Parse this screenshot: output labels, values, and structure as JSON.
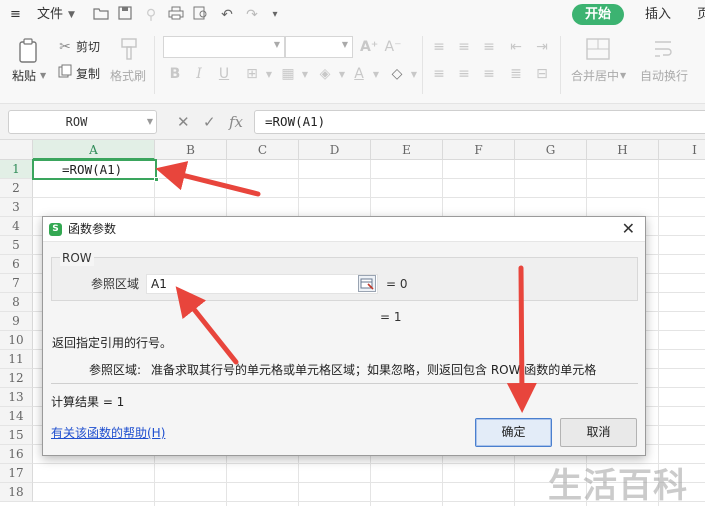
{
  "menubar": {
    "menu_icon": "hamburger-icon",
    "file_label": "文件",
    "file_dropdown": "chevron-down-icon",
    "quick_access": [
      "open-folder-icon",
      "save-icon",
      "format-painter-icon",
      "print-icon",
      "print-preview-icon",
      "undo-icon",
      "redo-icon",
      "customize-icon"
    ],
    "tab_start": "开始",
    "tab_insert": "插入",
    "tab_page": "页"
  },
  "ribbon": {
    "paste_label": "粘贴",
    "cut_label": "剪切",
    "copy_label": "复制",
    "format_painter_label": "格式刷",
    "merge_center_label": "合并居中",
    "wrap_text_label": "自动换行"
  },
  "formula_bar": {
    "name_box": "ROW",
    "fx_label": "fx",
    "formula": "=ROW(A1)"
  },
  "sheet": {
    "columns": [
      "A",
      "B",
      "C",
      "D",
      "E",
      "F",
      "G",
      "H",
      "I"
    ],
    "rows": [
      "1",
      "2",
      "3",
      "4",
      "5",
      "6",
      "7",
      "8",
      "9",
      "10",
      "11",
      "12",
      "13",
      "14",
      "15",
      "16",
      "17",
      "18"
    ],
    "active_cell_text": "=ROW(A1)"
  },
  "dialog": {
    "title": "函数参数",
    "function_name": "ROW",
    "arg_label": "参照区域",
    "arg_value": "A1",
    "arg_result": "= 0",
    "result_preview": "= 1",
    "function_description": "返回指定引用的行号。",
    "arg_desc_label": "参照区域:",
    "arg_desc_text": "准备求取其行号的单元格或单元格区域；如果忽略，则返回包含 ROW 函数的单元格",
    "calc_result": "计算结果 = 1",
    "help_link": "有关该函数的帮助(H)",
    "ok_label": "确定",
    "cancel_label": "取消"
  },
  "watermark": "生活百科",
  "colors": {
    "accent_green": "#3aa55d",
    "arrow_red": "#e8453c",
    "link_blue": "#1f4fcf"
  }
}
